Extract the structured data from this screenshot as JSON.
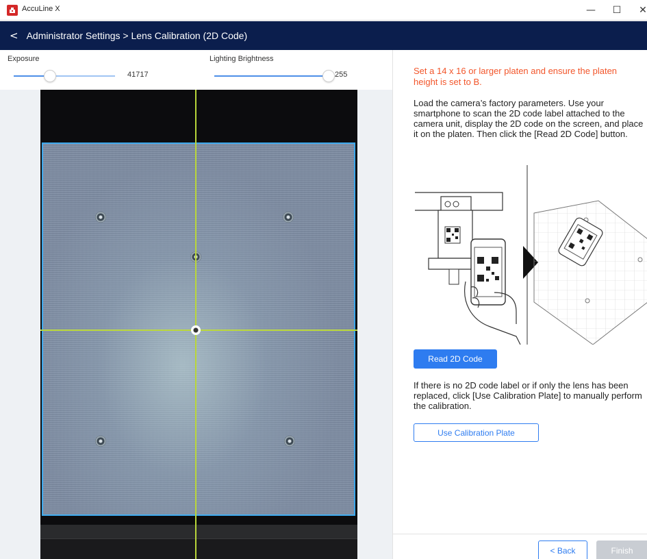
{
  "window": {
    "title": "AccuLine X",
    "minimize_glyph": "—",
    "maximize_glyph": "☐",
    "close_glyph": "✕"
  },
  "header": {
    "back_glyph": "<",
    "breadcrumb": "Administrator Settings > Lens Calibration (2D Code)"
  },
  "controls": {
    "exposure": {
      "label": "Exposure",
      "value": "41717",
      "level": 0.36
    },
    "brightness": {
      "label": "Lighting Brightness",
      "value": "255",
      "level": 1.0
    }
  },
  "instructions": {
    "warning": "Set a 14 x 16 or larger platen and ensure the platen height is set to B.",
    "load": "Load the camera’s factory parameters. Use your smartphone to scan the 2D code label attached to the camera unit, display the 2D code on the screen, and place it on the platen. Then click the [Read 2D Code] button.",
    "note": "If there is no 2D code label or if only the lens has been replaced, click [Use Calibration Plate] to manually perform the calibration."
  },
  "buttons": {
    "read_2d_code": "Read 2D Code",
    "use_calibration_plate": "Use Calibration Plate",
    "back": "< Back",
    "finish": "Finish"
  },
  "colors": {
    "header_bg": "#0b1e4d",
    "accent": "#2e7cf0",
    "warning": "#f2552a",
    "crosshair": "#b9d63a",
    "platen_border": "#3da8ec",
    "disabled": "#c9cdd3"
  }
}
